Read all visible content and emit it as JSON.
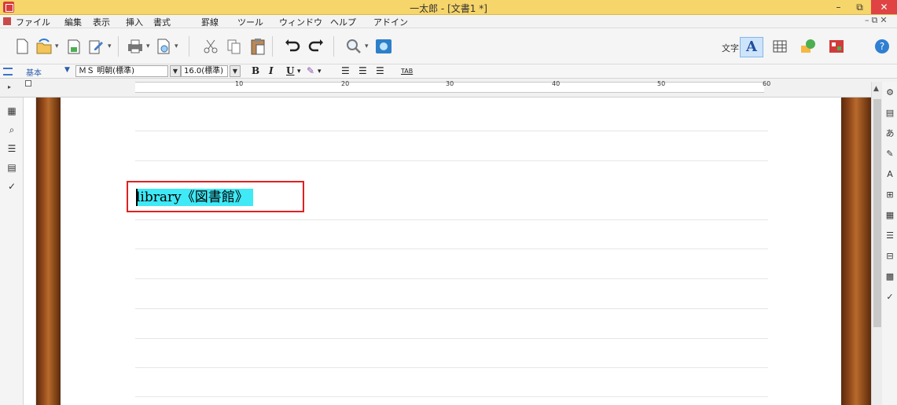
{
  "window": {
    "title": "一太郎 - [文書1 *]",
    "min_glyph": "–",
    "max_glyph": "⧉",
    "close_glyph": "✕"
  },
  "menu": {
    "items": [
      "ファイル",
      "編集",
      "表示",
      "挿入",
      "書式",
      "罫線",
      "ツール",
      "ウィンドウ",
      "ヘルプ",
      "アドイン"
    ],
    "right_glyphs": "–⧉✕"
  },
  "toolbar": {
    "mode_label": "文字",
    "mode_a_label": "A",
    "icons": [
      "new-doc-icon",
      "open-icon",
      "save-icon",
      "save-as-icon",
      "print-icon",
      "preview-icon",
      "cut-icon",
      "copy-icon",
      "paste-icon",
      "undo-icon",
      "redo-icon",
      "search-icon",
      "addon-icon",
      "table-icon",
      "shape-icon",
      "toolbox-icon",
      "help-icon"
    ]
  },
  "format": {
    "style": "基本",
    "font": "ＭＳ 明朝(標準)",
    "size": "16.0(標準)",
    "bold": "B",
    "italic": "I",
    "underline": "U",
    "tab": "TAB"
  },
  "ruler": {
    "numbers": [
      "10",
      "20",
      "30",
      "40",
      "50",
      "60"
    ]
  },
  "document": {
    "text": "library《図書館》"
  },
  "colors": {
    "highlight": "#3fe9f6",
    "selection_box": "#e02020",
    "titlebar": "#f6d56a",
    "close_button": "#e04343"
  }
}
